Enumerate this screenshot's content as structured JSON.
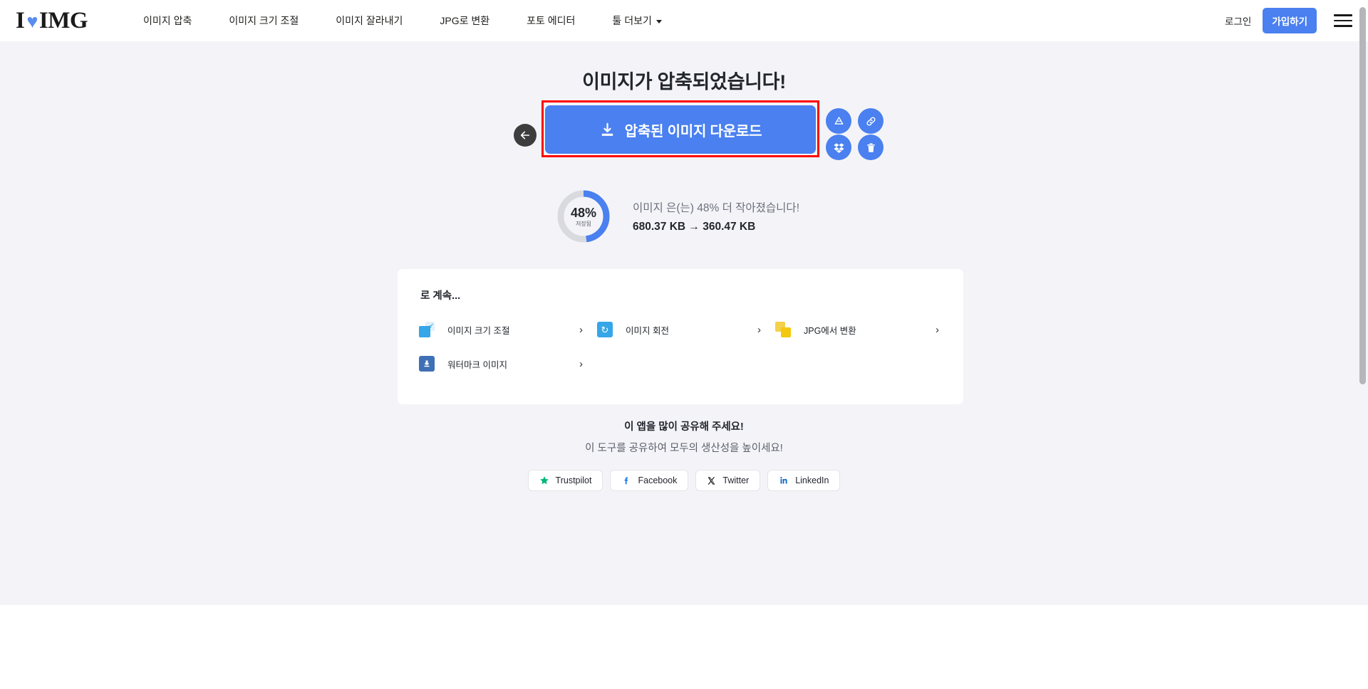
{
  "header": {
    "logo": {
      "i": "I",
      "heart": "♥",
      "img": "IMG"
    },
    "nav": [
      {
        "label": "이미지 압축",
        "has_caret": false
      },
      {
        "label": "이미지 크기 조절",
        "has_caret": false
      },
      {
        "label": "이미지 잘라내기",
        "has_caret": false
      },
      {
        "label": "JPG로 변환",
        "has_caret": false
      },
      {
        "label": "포토 에디터",
        "has_caret": false
      },
      {
        "label": "툴 더보기",
        "has_caret": true
      }
    ],
    "login_label": "로그인",
    "signup_label": "가입하기",
    "menu_icon": "hamburger-icon"
  },
  "main": {
    "title": "이미지가 압축되었습니다!",
    "download_button": "압축된 이미지 다운로드",
    "download_icon": "download-icon",
    "back_icon": "arrow-left-icon",
    "highlight_color": "#ff0000",
    "accent_color": "#4a80ef",
    "side_actions": [
      {
        "name": "google-drive-icon",
        "label": "Google Drive"
      },
      {
        "name": "link-icon",
        "label": "링크 복사"
      },
      {
        "name": "dropbox-icon",
        "label": "Dropbox"
      },
      {
        "name": "trash-icon",
        "label": "삭제"
      }
    ],
    "savings": {
      "percent": 48,
      "percent_label": "48%",
      "saved_label": "저장됨",
      "line1": "이미지 은(는) 48% 더 작아졌습니다!",
      "line2": "680.37 KB → 360.47 KB",
      "original_size": "680.37 KB",
      "compressed_size": "360.47 KB",
      "track_color": "#d9dade",
      "arc_color": "#4a80ef"
    }
  },
  "continue": {
    "title": "로 계속...",
    "items": [
      {
        "label": "이미지 크기 조절",
        "icon": "resize-image-icon",
        "chevron": "›"
      },
      {
        "label": "이미지 회전",
        "icon": "rotate-image-icon",
        "chevron": "›"
      },
      {
        "label": "JPG에서 변환",
        "icon": "convert-from-jpg-icon",
        "chevron": "›"
      },
      {
        "label": "워터마크 이미지",
        "icon": "watermark-image-icon",
        "chevron": "›"
      }
    ]
  },
  "share": {
    "title": "이 앱을 많이 공유해 주세요!",
    "subtitle": "이 도구를 공유하여 모두의 생산성을 높이세요!",
    "buttons": [
      {
        "label": "Trustpilot",
        "icon": "star-icon",
        "color": "#00b67a"
      },
      {
        "label": "Facebook",
        "icon": "facebook-icon",
        "color": "#1877f2"
      },
      {
        "label": "Twitter",
        "icon": "x-twitter-icon",
        "color": "#000000"
      },
      {
        "label": "LinkedIn",
        "icon": "linkedin-icon",
        "color": "#0a66c2"
      }
    ]
  }
}
